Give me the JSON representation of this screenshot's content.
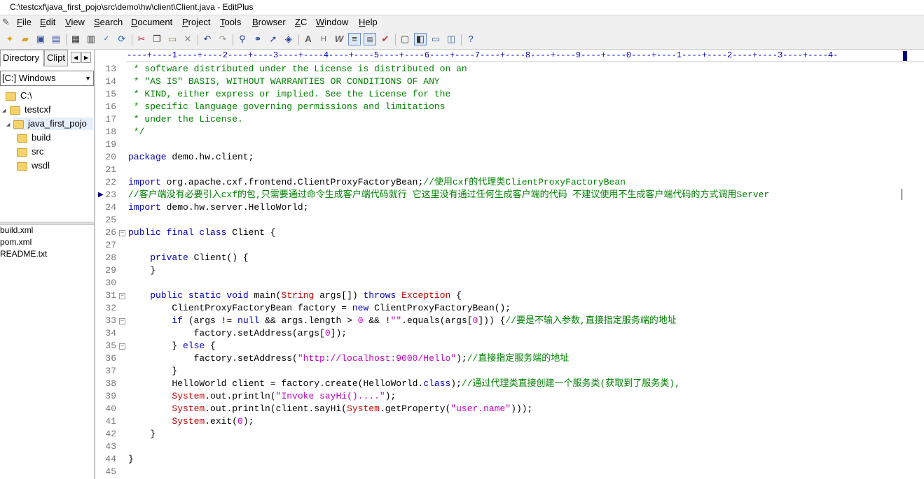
{
  "window": {
    "title": "C:\\testcxf\\java_first_pojo\\src\\demo\\hw\\client\\Client.java - EditPlus"
  },
  "menu": [
    "File",
    "Edit",
    "View",
    "Search",
    "Document",
    "Project",
    "Tools",
    "Browser",
    "ZC",
    "Window",
    "Help"
  ],
  "sidebar": {
    "tabs": [
      "Directory",
      "Clipt"
    ],
    "drive": "[C:] Windows",
    "tree": [
      "C:\\",
      "testcxf",
      "java_first_pojo",
      "build",
      "src",
      "wsdl"
    ],
    "files": [
      "build.xml",
      "pom.xml",
      "README.txt"
    ]
  },
  "ruler": "----+----1----+----2----+----3----+----4----+----5----+----6----+----7----+----8----+----9----+----0----+----1----+----2----+----3----+----4-",
  "editor": {
    "line_numbers": [
      "13",
      "14",
      "15",
      "16",
      "17",
      "18",
      "19",
      "20",
      "21",
      "22",
      "23",
      "24",
      "25",
      "26",
      "27",
      "28",
      "29",
      "30",
      "31",
      "32",
      "33",
      "34",
      "35",
      "36",
      "37",
      "38",
      "39",
      "40",
      "41",
      "42",
      "43",
      "44",
      "45"
    ],
    "lines": [
      [
        {
          "t": " * software distributed under the License is distributed on an",
          "c": "cm"
        }
      ],
      [
        {
          "t": " * \"AS IS\" BASIS, WITHOUT WARRANTIES OR CONDITIONS OF ANY",
          "c": "cm"
        }
      ],
      [
        {
          "t": " * KIND, either express or implied. See the License for the",
          "c": "cm"
        }
      ],
      [
        {
          "t": " * specific language governing permissions and limitations",
          "c": "cm"
        }
      ],
      [
        {
          "t": " * under the License.",
          "c": "cm"
        }
      ],
      [
        {
          "t": " */",
          "c": "cm"
        }
      ],
      [],
      [
        {
          "t": "package",
          "c": "kw"
        },
        {
          "t": " demo.hw.client;",
          "c": ""
        }
      ],
      [],
      [
        {
          "t": "import",
          "c": "kw"
        },
        {
          "t": " org.apache.cxf.frontend.ClientProxyFactoryBean;",
          "c": ""
        },
        {
          "t": "//使用cxf的代理类ClientProxyFactoryBean",
          "c": "cm"
        }
      ],
      [
        {
          "t": "//客户端没有必要引入cxf的包,只需要通过命令生成客户端代码就行 它这里没有通过任何生成客户端的代码 不建议使用不生成客户端代码的方式调用Server",
          "c": "cm"
        }
      ],
      [
        {
          "t": "import",
          "c": "kw"
        },
        {
          "t": " demo.hw.server.HelloWorld;",
          "c": ""
        }
      ],
      [],
      [
        {
          "t": "public final class",
          "c": "kw"
        },
        {
          "t": " Client {",
          "c": ""
        }
      ],
      [],
      [
        {
          "t": "    ",
          "c": ""
        },
        {
          "t": "private",
          "c": "kw"
        },
        {
          "t": " Client() {",
          "c": ""
        }
      ],
      [
        {
          "t": "    }",
          "c": ""
        }
      ],
      [],
      [
        {
          "t": "    ",
          "c": ""
        },
        {
          "t": "public static void",
          "c": "kw"
        },
        {
          "t": " main(",
          "c": ""
        },
        {
          "t": "String",
          "c": "cls"
        },
        {
          "t": " args[]) ",
          "c": ""
        },
        {
          "t": "throws",
          "c": "kw"
        },
        {
          "t": " ",
          "c": ""
        },
        {
          "t": "Exception",
          "c": "cls"
        },
        {
          "t": " {",
          "c": ""
        }
      ],
      [
        {
          "t": "        ClientProxyFactoryBean factory = ",
          "c": ""
        },
        {
          "t": "new",
          "c": "kw"
        },
        {
          "t": " ClientProxyFactoryBean();",
          "c": ""
        }
      ],
      [
        {
          "t": "        ",
          "c": ""
        },
        {
          "t": "if",
          "c": "kw"
        },
        {
          "t": " (args != ",
          "c": ""
        },
        {
          "t": "null",
          "c": "kw"
        },
        {
          "t": " && args.length > ",
          "c": ""
        },
        {
          "t": "0",
          "c": "str"
        },
        {
          "t": " && !",
          "c": ""
        },
        {
          "t": "\"\"",
          "c": "str"
        },
        {
          "t": ".equals(args[",
          "c": ""
        },
        {
          "t": "0",
          "c": "str"
        },
        {
          "t": "])) {",
          "c": ""
        },
        {
          "t": "//要是不输入参数,直接指定服务端的地址",
          "c": "cm"
        }
      ],
      [
        {
          "t": "            factory.setAddress(args[",
          "c": ""
        },
        {
          "t": "0",
          "c": "str"
        },
        {
          "t": "]);",
          "c": ""
        }
      ],
      [
        {
          "t": "        } ",
          "c": ""
        },
        {
          "t": "else",
          "c": "kw"
        },
        {
          "t": " {",
          "c": ""
        }
      ],
      [
        {
          "t": "            factory.setAddress(",
          "c": ""
        },
        {
          "t": "\"http://localhost:9000/Hello\"",
          "c": "str"
        },
        {
          "t": ");",
          "c": ""
        },
        {
          "t": "//直接指定服务端的地址",
          "c": "cm"
        }
      ],
      [
        {
          "t": "        }",
          "c": ""
        }
      ],
      [
        {
          "t": "        HelloWorld client = factory.create(HelloWorld.",
          "c": ""
        },
        {
          "t": "class",
          "c": "kw"
        },
        {
          "t": ");",
          "c": ""
        },
        {
          "t": "//通过代理类直接创建一个服务类(获取到了服务类),",
          "c": "cm"
        }
      ],
      [
        {
          "t": "        ",
          "c": ""
        },
        {
          "t": "System",
          "c": "cls"
        },
        {
          "t": ".out.println(",
          "c": ""
        },
        {
          "t": "\"Invoke sayHi()....\"",
          "c": "str"
        },
        {
          "t": ");",
          "c": ""
        }
      ],
      [
        {
          "t": "        ",
          "c": ""
        },
        {
          "t": "System",
          "c": "cls"
        },
        {
          "t": ".out.println(client.sayHi(",
          "c": ""
        },
        {
          "t": "System",
          "c": "cls"
        },
        {
          "t": ".getProperty(",
          "c": ""
        },
        {
          "t": "\"user.name\"",
          "c": "str"
        },
        {
          "t": ")));",
          "c": ""
        }
      ],
      [
        {
          "t": "        ",
          "c": ""
        },
        {
          "t": "System",
          "c": "cls"
        },
        {
          "t": ".exit(",
          "c": ""
        },
        {
          "t": "0",
          "c": "str"
        },
        {
          "t": ");",
          "c": ""
        }
      ],
      [
        {
          "t": "    }",
          "c": ""
        }
      ],
      [],
      [
        {
          "t": "}",
          "c": ""
        }
      ],
      []
    ]
  },
  "icons": [
    "pencil-icon",
    "new-file-icon",
    "open-icon",
    "save-icon",
    "save-all-icon",
    "print-preview-icon",
    "print-icon",
    "spell-check-icon",
    "find-icon",
    "sync-icon",
    "cut-icon",
    "copy-icon",
    "paste-icon",
    "delete-icon",
    "undo-icon",
    "redo-icon",
    "search-icon",
    "replace-icon",
    "goto-icon",
    "hex-icon",
    "hx-icon",
    "word-icon",
    "wrap-icon",
    "ruler-icon",
    "sort-icon",
    "check-icon",
    "fullscreen-icon",
    "panel-icon",
    "output-icon",
    "cliptext-icon",
    "help-icon"
  ]
}
